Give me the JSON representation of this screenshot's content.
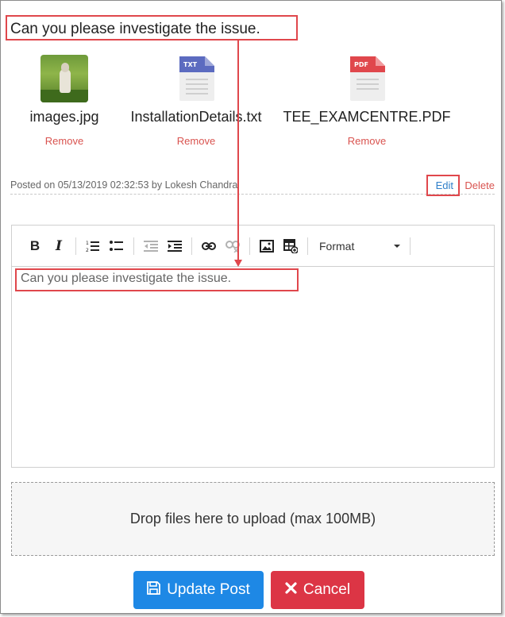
{
  "post": {
    "text": "Can you please investigate the issue."
  },
  "attachments": [
    {
      "filename": "images.jpg",
      "remove_label": "Remove",
      "type": "image"
    },
    {
      "filename": "InstallationDetails.txt",
      "remove_label": "Remove",
      "type": "txt",
      "badge": "TXT"
    },
    {
      "filename": "TEE_EXAMCENTRE.PDF",
      "remove_label": "Remove",
      "type": "pdf",
      "badge": "PDF"
    }
  ],
  "meta": {
    "posted_text": "Posted on 05/13/2019 02:32:53 by Lokesh Chandra",
    "edit_label": "Edit",
    "delete_label": "Delete"
  },
  "editor": {
    "toolbar": {
      "format_label": "Format"
    },
    "content": "Can you please investigate the issue."
  },
  "dropzone": {
    "label": "Drop files here to upload (max 100MB)"
  },
  "actions": {
    "update_label": "Update Post",
    "cancel_label": "Cancel"
  },
  "colors": {
    "primary": "#1e88e5",
    "danger": "#dc3545",
    "callout": "#e0474c",
    "link": "#2f7fc9",
    "txt_icon": "#5c6bc0",
    "pdf_icon": "#e0474c"
  }
}
